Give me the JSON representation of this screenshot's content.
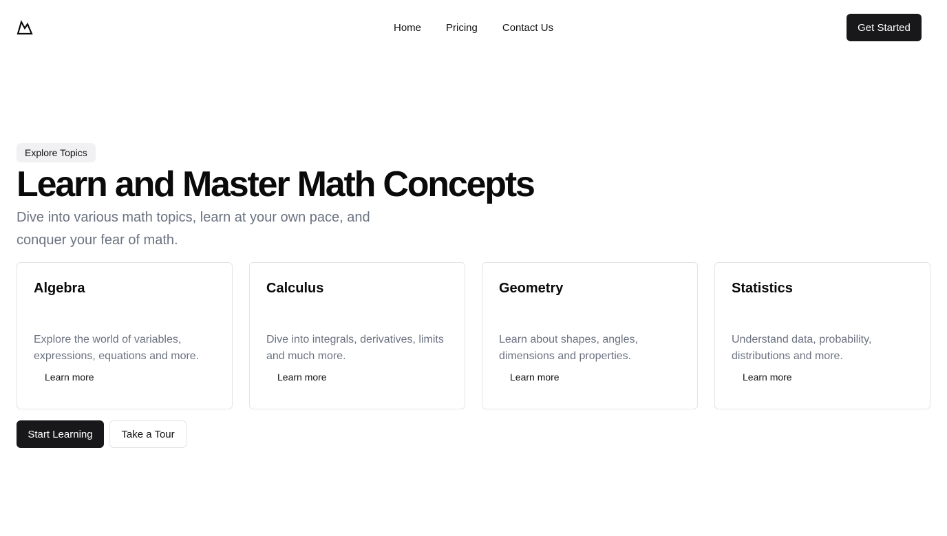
{
  "nav": {
    "logo_icon": "mountain-logo-icon",
    "links": [
      {
        "label": "Home"
      },
      {
        "label": "Pricing"
      },
      {
        "label": "Contact Us"
      }
    ],
    "cta_label": "Get Started"
  },
  "hero": {
    "badge": "Explore Topics",
    "title": "Learn and Master Math Concepts",
    "subtitle": "Dive into various math topics, learn at your own pace, and conquer your fear of math."
  },
  "cards": [
    {
      "title": "Algebra",
      "description": "Explore the world of variables, expressions, equations and more.",
      "link": "Learn more"
    },
    {
      "title": "Calculus",
      "description": "Dive into integrals, derivatives, limits and much more.",
      "link": "Learn more"
    },
    {
      "title": "Geometry",
      "description": "Learn about shapes, angles, dimensions and properties.",
      "link": "Learn more"
    },
    {
      "title": "Statistics",
      "description": "Understand data, probability, distributions and more.",
      "link": "Learn more"
    }
  ],
  "actions": {
    "primary_label": "Start Learning",
    "secondary_label": "Take a Tour"
  },
  "colors": {
    "primary": "#18181b",
    "muted_text": "#6b7280",
    "badge_bg": "#f1f1f3",
    "border": "#e4e4e7"
  }
}
